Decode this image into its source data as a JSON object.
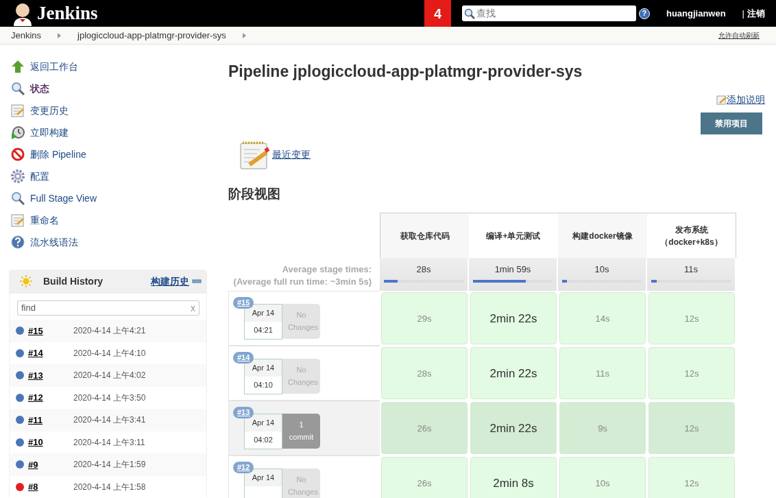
{
  "header": {
    "logo_text": "Jenkins",
    "notification_count": "4",
    "search": {
      "placeholder": "查找"
    },
    "help": "?",
    "user": "huangjianwen",
    "separator": "|",
    "logout": "注销"
  },
  "breadcrumbs": [
    "Jenkins",
    "jplogiccloud-app-platmgr-provider-sys"
  ],
  "auto_refresh": "允许自动刷新",
  "sidebar": {
    "items": [
      {
        "label": "返回工作台",
        "selected": false
      },
      {
        "label": "状态",
        "selected": true
      },
      {
        "label": "变更历史",
        "selected": false
      },
      {
        "label": "立即构建",
        "selected": false
      },
      {
        "label": "删除 Pipeline",
        "selected": false
      },
      {
        "label": "配置",
        "selected": false
      },
      {
        "label": "Full Stage View",
        "selected": false
      },
      {
        "label": "重命名",
        "selected": false
      },
      {
        "label": "流水线语法",
        "selected": false
      }
    ]
  },
  "build_history": {
    "title": "Build History",
    "trend_link": "构建历史",
    "filter": {
      "value": "find",
      "clear": "x"
    },
    "builds": [
      {
        "number": "#15",
        "time": "2020-4-14 上午4:21",
        "color": "#4a76b8"
      },
      {
        "number": "#14",
        "time": "2020-4-14 上午4:10",
        "color": "#4a76b8"
      },
      {
        "number": "#13",
        "time": "2020-4-14 上午4:02",
        "color": "#4a76b8"
      },
      {
        "number": "#12",
        "time": "2020-4-14 上午3:50",
        "color": "#4a76b8"
      },
      {
        "number": "#11",
        "time": "2020-4-14 上午3:41",
        "color": "#4a76b8"
      },
      {
        "number": "#10",
        "time": "2020-4-14 上午3:11",
        "color": "#4a76b8"
      },
      {
        "number": "#9",
        "time": "2020-4-14 上午1:59",
        "color": "#4a76b8"
      },
      {
        "number": "#8",
        "time": "2020-4-14 上午1:58",
        "color": "#e02020"
      }
    ]
  },
  "main": {
    "title": "Pipeline jplogiccloud-app-platmgr-provider-sys",
    "add_description": "添加说明",
    "disable_button": "禁用项目",
    "recent_changes": "最近变更",
    "stage_view_title": "阶段视图"
  },
  "stage_view": {
    "average_label": "Average stage times:",
    "average_full": "(Average **full** run time: ~3min 5s)",
    "stages": [
      {
        "name": "获取仓库代码",
        "average": "28s",
        "level": 0.17
      },
      {
        "name": "编译+单元测试",
        "average": "1min 59s",
        "level": 0.66
      },
      {
        "name": "构建docker镜像",
        "average": "10s",
        "level": 0.06
      },
      {
        "name": "发布系统",
        "note": "（docker+k8s）",
        "average": "11s",
        "level": 0.07
      }
    ],
    "runs": [
      {
        "number": "#15",
        "date": "Apr 14",
        "time": "04:21",
        "changes": "No Changes",
        "kind": "none",
        "selected": false,
        "durations": [
          {
            "text": "29s",
            "long": false
          },
          {
            "text": "2min 22s",
            "long": true
          },
          {
            "text": "14s",
            "long": false
          },
          {
            "text": "12s",
            "long": false
          }
        ]
      },
      {
        "number": "#14",
        "date": "Apr 14",
        "time": "04:10",
        "changes": "No Changes",
        "kind": "none",
        "selected": false,
        "durations": [
          {
            "text": "28s",
            "long": false
          },
          {
            "text": "2min 22s",
            "long": true
          },
          {
            "text": "11s",
            "long": false
          },
          {
            "text": "12s",
            "long": false
          }
        ]
      },
      {
        "number": "#13",
        "date": "Apr 14",
        "time": "04:02",
        "changes": "1 commit",
        "kind": "commits",
        "selected": true,
        "durations": [
          {
            "text": "26s",
            "long": false
          },
          {
            "text": "2min 22s",
            "long": true
          },
          {
            "text": "9s",
            "long": false
          },
          {
            "text": "12s",
            "long": false
          }
        ]
      },
      {
        "number": "#12",
        "date": "Apr 14",
        "changes": "No Changes",
        "kind": "none",
        "selected": false,
        "durations": [
          {
            "text": "26s",
            "long": false
          },
          {
            "text": "2min 8s",
            "long": true
          },
          {
            "text": "10s",
            "long": false
          },
          {
            "text": "12s",
            "long": false
          }
        ]
      }
    ]
  }
}
